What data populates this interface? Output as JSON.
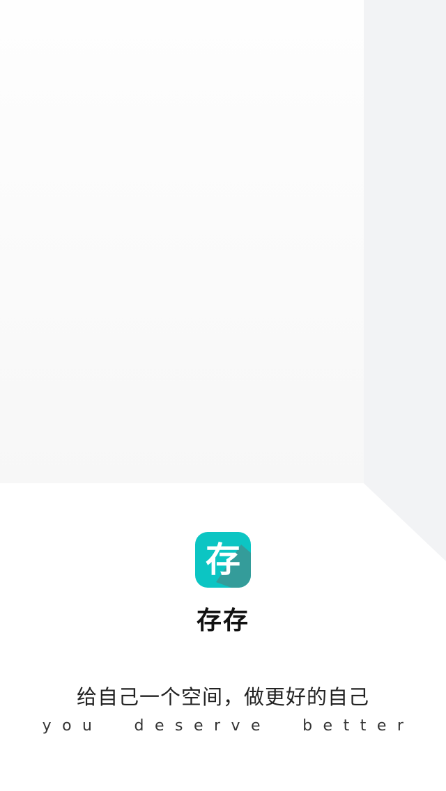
{
  "splash": {
    "app_name": "存存",
    "logo_glyph": "存",
    "logo_icon": "app-logo-icon",
    "slogan_cn": "给自己一个空间，做更好的自己",
    "slogan_en": "you  deserve  better"
  },
  "colors": {
    "logo_bg": "#0cc5c3",
    "logo_shadow": "#349c9a",
    "background": "#ffffff",
    "back_wall": "#f9f9f9",
    "side_wall": "#f2f3f5"
  }
}
